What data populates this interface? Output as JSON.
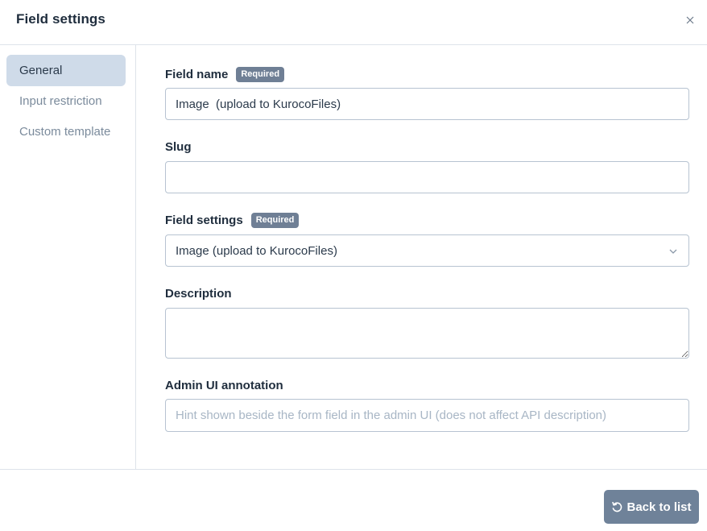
{
  "dialog": {
    "title": "Field settings",
    "close_icon": "close-icon"
  },
  "sidebar": {
    "items": [
      {
        "label": "General",
        "active": true
      },
      {
        "label": "Input restriction",
        "active": false
      },
      {
        "label": "Custom template",
        "active": false
      }
    ]
  },
  "form": {
    "field_name": {
      "label": "Field name",
      "badge": "Required",
      "value": "Image  (upload to KurocoFiles)"
    },
    "slug": {
      "label": "Slug",
      "value": ""
    },
    "field_settings": {
      "label": "Field settings",
      "badge": "Required",
      "selected": "Image (upload to KurocoFiles)"
    },
    "description": {
      "label": "Description",
      "value": ""
    },
    "admin_annotation": {
      "label": "Admin UI annotation",
      "placeholder": "Hint shown beside the form field in the admin UI (does not affect API description)"
    }
  },
  "footer": {
    "back_label": "Back to list",
    "back_icon": "undo-icon"
  },
  "colors": {
    "accent_button": "#6f8299",
    "badge": "#6f7f95",
    "active_nav": "#cfdbe9"
  }
}
